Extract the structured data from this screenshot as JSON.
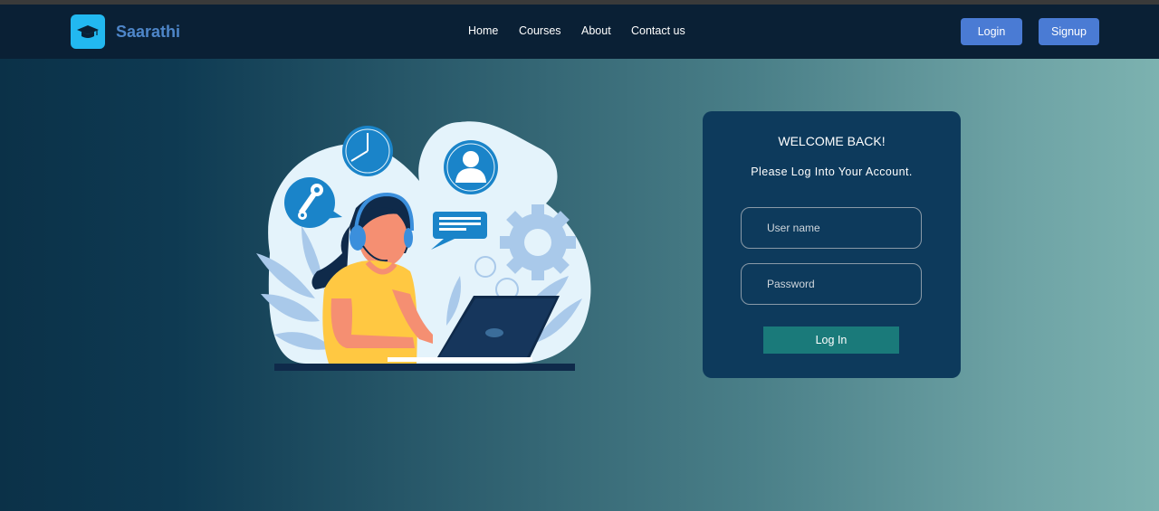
{
  "header": {
    "brand": "Saarathi",
    "logo_icon": "graduation-cap-icon",
    "nav": [
      "Home",
      "Courses",
      "About",
      "Contact us"
    ],
    "login_label": "Login",
    "signup_label": "Signup"
  },
  "login_card": {
    "title": "WELCOME BACK!",
    "subtitle": "Please Log Into Your Account.",
    "username_placeholder": "User name",
    "password_placeholder": "Password",
    "submit_label": "Log In"
  },
  "illustration": {
    "icons": [
      "clock-icon",
      "user-icon",
      "wrench-icon",
      "chat-icon",
      "gear-icon"
    ]
  },
  "colors": {
    "navbar": "#0a2035",
    "accent_button": "#4a7bd4",
    "card": "#0d3a5c",
    "submit": "#1a7a7a",
    "brand": "#4e86c9"
  }
}
